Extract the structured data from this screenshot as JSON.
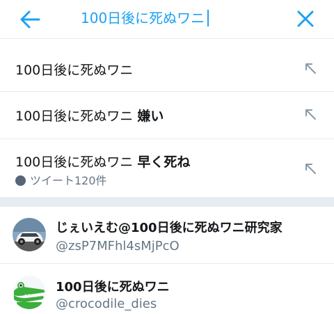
{
  "search": {
    "query": "100日後に死ぬワニ",
    "back_icon": "arrow-left-icon",
    "clear_icon": "close-icon",
    "accent_color": "#1da1f2"
  },
  "suggestions": [
    {
      "prefix": "100日後に死ぬワニ",
      "suffix": ""
    },
    {
      "prefix": "100日後に死ぬワニ",
      "suffix": "嫌い"
    },
    {
      "prefix": "100日後に死ぬワニ",
      "suffix": "早く死ね",
      "meta": "ツイート120件"
    }
  ],
  "users": [
    {
      "name": "じぇいえむ@100日後に死ぬワニ研究家",
      "handle": "@zsP7MFhl4sMjPcO"
    },
    {
      "name": "100日後に死ぬワニ",
      "handle": "@crocodile_dies"
    }
  ]
}
